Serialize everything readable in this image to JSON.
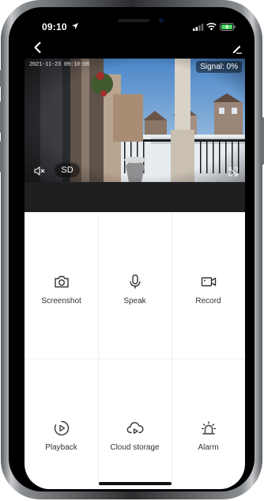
{
  "status_bar": {
    "time": "09:10"
  },
  "video": {
    "timestamp": "2021-11-23 09:10:08",
    "signal_label": "Signal: 0%",
    "quality_label": "SD"
  },
  "controls": [
    {
      "label": "Screenshot",
      "icon": "camera-icon"
    },
    {
      "label": "Speak",
      "icon": "microphone-icon"
    },
    {
      "label": "Record",
      "icon": "video-camera-icon"
    },
    {
      "label": "Playback",
      "icon": "play-circle-icon"
    },
    {
      "label": "Cloud storage",
      "icon": "cloud-play-icon"
    },
    {
      "label": "Alarm",
      "icon": "siren-icon"
    }
  ],
  "colors": {
    "icon": "#333333",
    "divider": "#efefef",
    "strip": "#1f1f21"
  }
}
